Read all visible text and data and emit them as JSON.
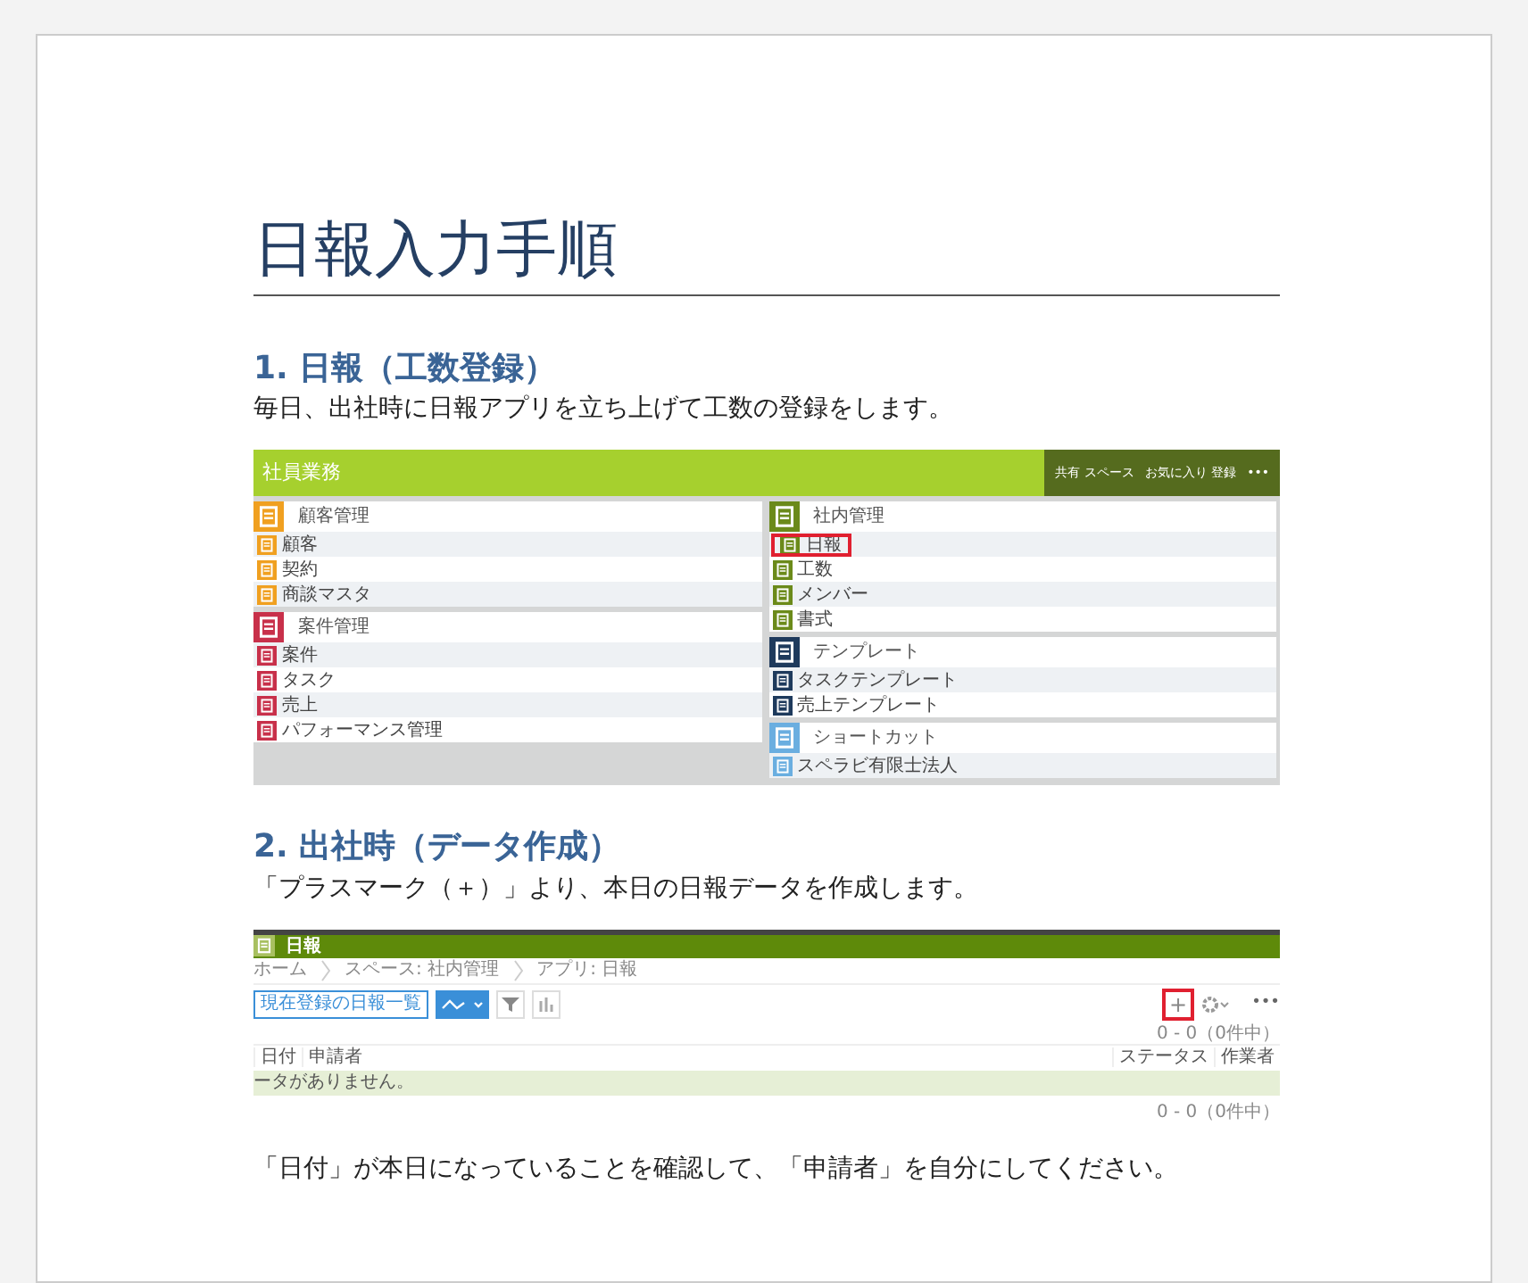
{
  "title": "日報入力手順",
  "sections": [
    {
      "heading": "1. 日報（工数登録）",
      "text": "毎日、出社時に日報アプリを立ち上げて工数の登録をします。",
      "portal": {
        "banner_title": "社員業務",
        "top_buttons": [
          "共有 スペース",
          "お気に入り 登録",
          "•••"
        ],
        "columns": [
          [
            {
              "title": "顧客管理",
              "color": "#f0a020",
              "items": [
                {
                  "label": "顧客",
                  "highlighted": false
                },
                {
                  "label": "契約",
                  "highlighted": false
                },
                {
                  "label": "商談マスタ",
                  "highlighted": false
                }
              ]
            },
            {
              "title": "案件管理",
              "color": "#c8304a",
              "items": [
                {
                  "label": "案件",
                  "highlighted": false
                },
                {
                  "label": "タスク",
                  "highlighted": false
                },
                {
                  "label": "売上",
                  "highlighted": false
                },
                {
                  "label": "パフォーマンス管理",
                  "highlighted": false
                }
              ]
            }
          ],
          [
            {
              "title": "社内管理",
              "color": "#6b8a1a",
              "items": [
                {
                  "label": "日報",
                  "highlighted": true
                },
                {
                  "label": "工数",
                  "highlighted": false
                },
                {
                  "label": "メンバー",
                  "highlighted": false
                },
                {
                  "label": "書式",
                  "highlighted": false
                }
              ]
            },
            {
              "title": "テンプレート",
              "color": "#1e3a5c",
              "items": [
                {
                  "label": "タスクテンプレート",
                  "highlighted": false
                },
                {
                  "label": "売上テンプレート",
                  "highlighted": false
                }
              ]
            },
            {
              "title": "ショートカット",
              "color": "#6aaee0",
              "items": [
                {
                  "label": "スペラビ有限士法人",
                  "highlighted": false
                }
              ]
            }
          ]
        ]
      }
    },
    {
      "heading": "2. 出社時（データ作成）",
      "text": "「プラスマーク（＋）」より、本日の日報データを作成します。",
      "app": {
        "app_title": "日報",
        "breadcrumbs": [
          "ホーム",
          "スペース: 社内管理",
          "アプリ: 日報"
        ],
        "view_select": "現在登録の日報一覧",
        "add_button": "+",
        "add_highlighted": true,
        "more_button": "•••",
        "pager_top": "0 - 0（0件中）",
        "columns": [
          "日付",
          "申請者",
          "ステータス",
          "作業者"
        ],
        "empty_message": "ータがありません。",
        "pager_bottom": "0 - 0（0件中）"
      }
    }
  ],
  "closing": "「日付」が本日になっていることを確認して、「申請者」を自分にしてください。"
}
